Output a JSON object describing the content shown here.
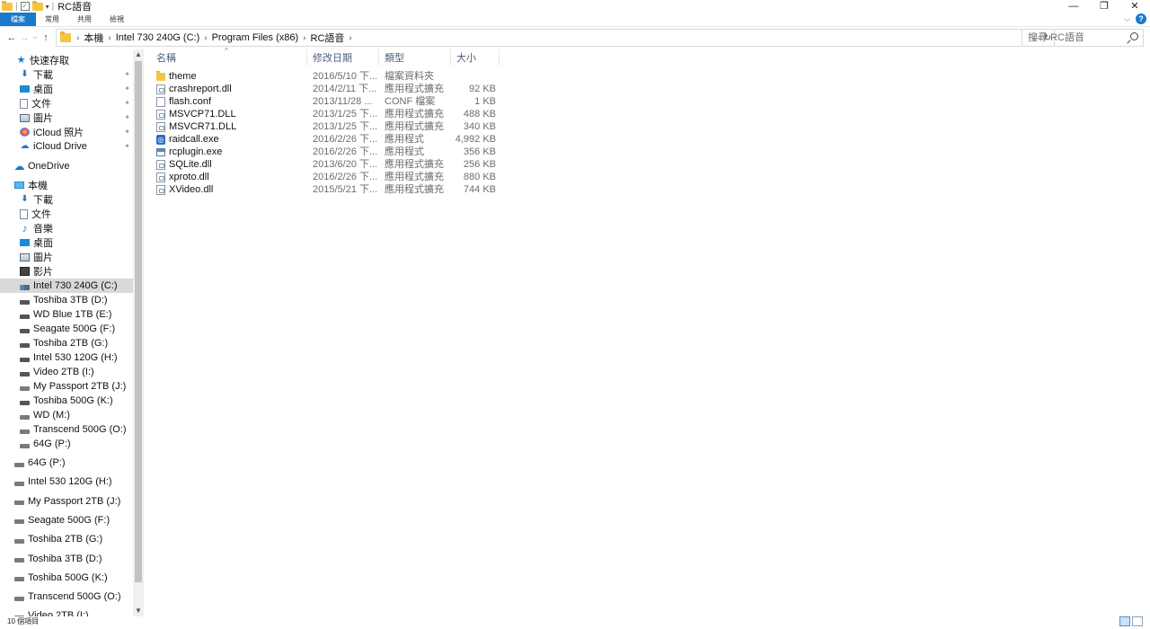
{
  "window": {
    "title": "RC語音",
    "controls": {
      "minimize": "—",
      "maximize": "❐",
      "close": "✕"
    }
  },
  "ribbon": {
    "tabs": [
      "檔案",
      "常用",
      "共用",
      "檢視"
    ]
  },
  "address": {
    "crumbs": [
      "本機",
      "Intel 730 240G (C:)",
      "Program Files (x86)",
      "RC語音"
    ],
    "search_placeholder": "搜尋 RC語音"
  },
  "nav": {
    "quick_access": "快速存取",
    "pinned": [
      {
        "label": "下載",
        "icon": "download-icon"
      },
      {
        "label": "桌面",
        "icon": "desktop-icon"
      },
      {
        "label": "文件",
        "icon": "documents-icon"
      },
      {
        "label": "圖片",
        "icon": "pictures-icon"
      },
      {
        "label": "iCloud 照片",
        "icon": "icloud-photos-icon"
      },
      {
        "label": "iCloud Drive",
        "icon": "icloud-drive-icon"
      }
    ],
    "onedrive": "OneDrive",
    "this_pc": "本機",
    "pc_items": [
      {
        "label": "下載",
        "icon": "download-icon"
      },
      {
        "label": "文件",
        "icon": "documents-icon"
      },
      {
        "label": "音樂",
        "icon": "music-icon"
      },
      {
        "label": "桌面",
        "icon": "desktop-icon"
      },
      {
        "label": "圖片",
        "icon": "pictures-icon"
      },
      {
        "label": "影片",
        "icon": "videos-icon"
      },
      {
        "label": "Intel 730 240G (C:)",
        "icon": "os-drive-icon",
        "selected": true
      },
      {
        "label": "Toshiba 3TB (D:)",
        "icon": "drive-icon"
      },
      {
        "label": "WD Blue 1TB (E:)",
        "icon": "drive-icon"
      },
      {
        "label": "Seagate 500G (F:)",
        "icon": "drive-icon"
      },
      {
        "label": "Toshiba 2TB (G:)",
        "icon": "drive-icon"
      },
      {
        "label": "Intel 530 120G (H:)",
        "icon": "drive-icon"
      },
      {
        "label": "Video 2TB (I:)",
        "icon": "drive-icon"
      },
      {
        "label": "My Passport 2TB (J:)",
        "icon": "removable-drive-icon"
      },
      {
        "label": "Toshiba 500G (K:)",
        "icon": "drive-icon"
      },
      {
        "label": "WD (M:)",
        "icon": "removable-drive-icon"
      },
      {
        "label": "Transcend 500G (O:)",
        "icon": "removable-drive-icon"
      },
      {
        "label": "64G (P:)",
        "icon": "removable-drive-icon"
      }
    ],
    "drives": [
      "64G (P:)",
      "Intel 530 120G (H:)",
      "My Passport 2TB (J:)",
      "Seagate 500G (F:)",
      "Toshiba 2TB (G:)",
      "Toshiba 3TB (D:)",
      "Toshiba 500G (K:)",
      "Transcend 500G (O:)",
      "Video 2TB (I:)"
    ]
  },
  "columns": {
    "name": "名稱",
    "date": "修改日期",
    "type": "類型",
    "size": "大小"
  },
  "files": [
    {
      "name": "theme",
      "date": "2016/5/10 下...",
      "type": "檔案資料夾",
      "size": "",
      "icon": "folder-icon"
    },
    {
      "name": "crashreport.dll",
      "date": "2014/2/11 下...",
      "type": "應用程式擴充",
      "size": "92 KB",
      "icon": "dll-icon"
    },
    {
      "name": "flash.conf",
      "date": "2013/11/28 ...",
      "type": "CONF 檔案",
      "size": "1 KB",
      "icon": "conf-icon"
    },
    {
      "name": "MSVCP71.DLL",
      "date": "2013/1/25 下...",
      "type": "應用程式擴充",
      "size": "488 KB",
      "icon": "dll-icon"
    },
    {
      "name": "MSVCR71.DLL",
      "date": "2013/1/25 下...",
      "type": "應用程式擴充",
      "size": "340 KB",
      "icon": "dll-icon"
    },
    {
      "name": "raidcall.exe",
      "date": "2016/2/26 下...",
      "type": "應用程式",
      "size": "4,992 KB",
      "icon": "raidcall-icon"
    },
    {
      "name": "rcplugin.exe",
      "date": "2016/2/26 下...",
      "type": "應用程式",
      "size": "356 KB",
      "icon": "exe-icon"
    },
    {
      "name": "SQLite.dll",
      "date": "2013/6/20 下...",
      "type": "應用程式擴充",
      "size": "256 KB",
      "icon": "dll-icon"
    },
    {
      "name": "xproto.dll",
      "date": "2016/2/26 下...",
      "type": "應用程式擴充",
      "size": "880 KB",
      "icon": "dll-icon"
    },
    {
      "name": "XVideo.dll",
      "date": "2015/5/21 下...",
      "type": "應用程式擴充",
      "size": "744 KB",
      "icon": "dll-icon"
    }
  ],
  "status": {
    "item_count": "10 個項目"
  }
}
